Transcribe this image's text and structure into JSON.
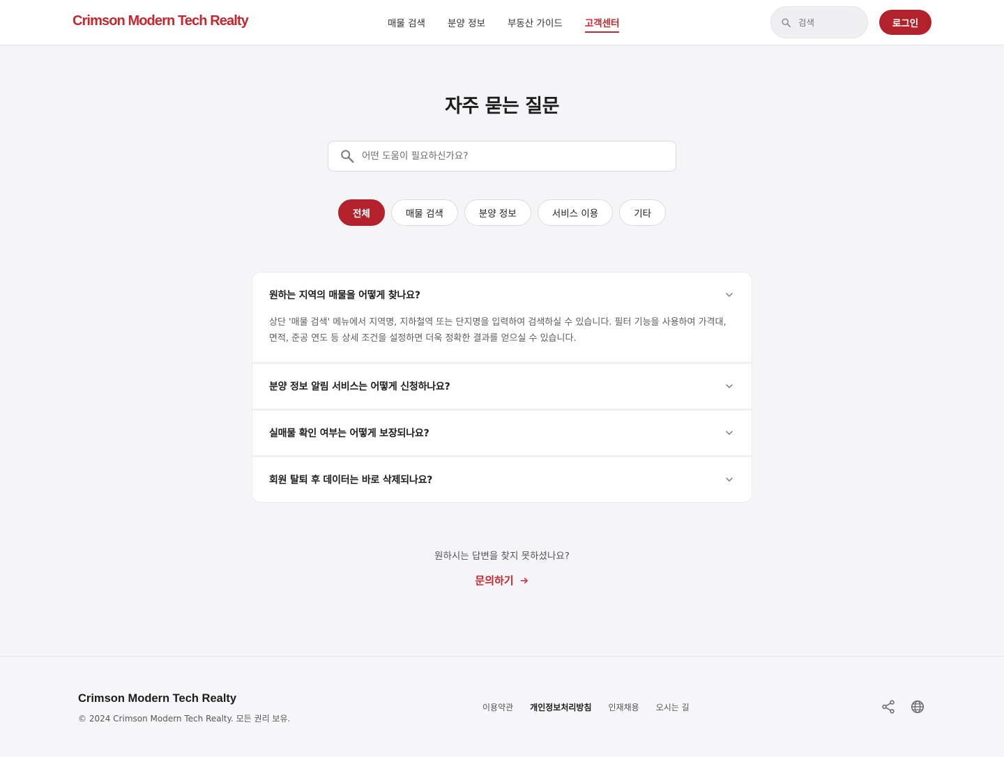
{
  "header": {
    "logo": "Crimson Modern Tech Realty",
    "nav": [
      {
        "label": "매물 검색",
        "active": false
      },
      {
        "label": "분양 정보",
        "active": false
      },
      {
        "label": "부동산 가이드",
        "active": false
      },
      {
        "label": "고객센터",
        "active": true
      }
    ],
    "search_placeholder": "검색",
    "login_label": "로그인"
  },
  "main": {
    "title": "자주 묻는 질문",
    "search_placeholder": "어떤 도움이 필요하신가요?",
    "categories": [
      {
        "label": "전체",
        "active": true
      },
      {
        "label": "매물 검색",
        "active": false
      },
      {
        "label": "분양 정보",
        "active": false
      },
      {
        "label": "서비스 이용",
        "active": false
      },
      {
        "label": "기타",
        "active": false
      }
    ],
    "faqs": [
      {
        "question": "원하는 지역의 매물을 어떻게 찾나요?",
        "answer": "상단 '매물 검색' 메뉴에서 지역명, 지하철역 또는 단지명을 입력하여 검색하실 수 있습니다. 필터 기능을 사용하여 가격대, 면적, 준공 연도 등 상세 조건을 설정하면 더욱 정확한 결과를 얻으실 수 있습니다.",
        "expanded": true
      },
      {
        "question": "분양 정보 알림 서비스는 어떻게 신청하나요?",
        "answer": "",
        "expanded": false
      },
      {
        "question": "실매물 확인 여부는 어떻게 보장되나요?",
        "answer": "",
        "expanded": false
      },
      {
        "question": "회원 탈퇴 후 데이터는 바로 삭제되나요?",
        "answer": "",
        "expanded": false
      }
    ],
    "help_text": "원하시는 답변을 찾지 못하셨나요?",
    "contact_label": "문의하기"
  },
  "footer": {
    "brand": "Crimson Modern Tech Realty",
    "copyright": "© 2024 Crimson Modern Tech Realty. 모든 권리 보유.",
    "links": [
      {
        "label": "이용약관",
        "strong": false
      },
      {
        "label": "개인정보처리방침",
        "strong": true
      },
      {
        "label": "인재채용",
        "strong": false
      },
      {
        "label": "오시는 길",
        "strong": false
      }
    ],
    "icons": [
      "share-icon",
      "globe-icon"
    ]
  },
  "colors": {
    "accent": "#b3212a",
    "logo": "#c8262c",
    "background": "#f5f5f7"
  }
}
